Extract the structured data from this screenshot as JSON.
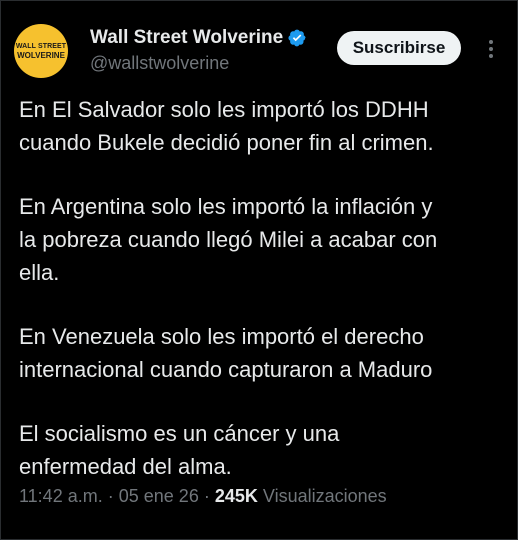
{
  "account": {
    "avatar_text_line1": "WALL STREET",
    "avatar_text_line2": "WOLVERINE",
    "display_name": "Wall Street Wolverine",
    "handle": "@wallstwolverine",
    "verified": true
  },
  "actions": {
    "subscribe_label": "Suscribirse",
    "more_icon": "more-vertical-icon"
  },
  "post": {
    "paragraphs": [
      [
        "En El Salvador solo les importó los DDHH",
        "cuando Bukele decidió poner fin al crimen."
      ],
      [
        "En Argentina solo les importó la inflación y",
        "la pobreza cuando llegó Milei a acabar con",
        "ella."
      ],
      [
        "En Venezuela solo les importó el derecho",
        "internacional cuando capturaron a Maduro"
      ],
      [
        "El socialismo es un cáncer y una",
        "enfermedad del alma."
      ]
    ]
  },
  "meta": {
    "time": "11:42 a.m.",
    "separator": "·",
    "date": "05 ene 26",
    "views_count": "245K",
    "views_label": "Visualizaciones"
  },
  "colors": {
    "background": "#000000",
    "text_primary": "#e7e9ea",
    "text_secondary": "#71767b",
    "verified_blue": "#1d9bf0",
    "avatar_yellow": "#f6c12e",
    "button_bg": "#eff3f4"
  }
}
